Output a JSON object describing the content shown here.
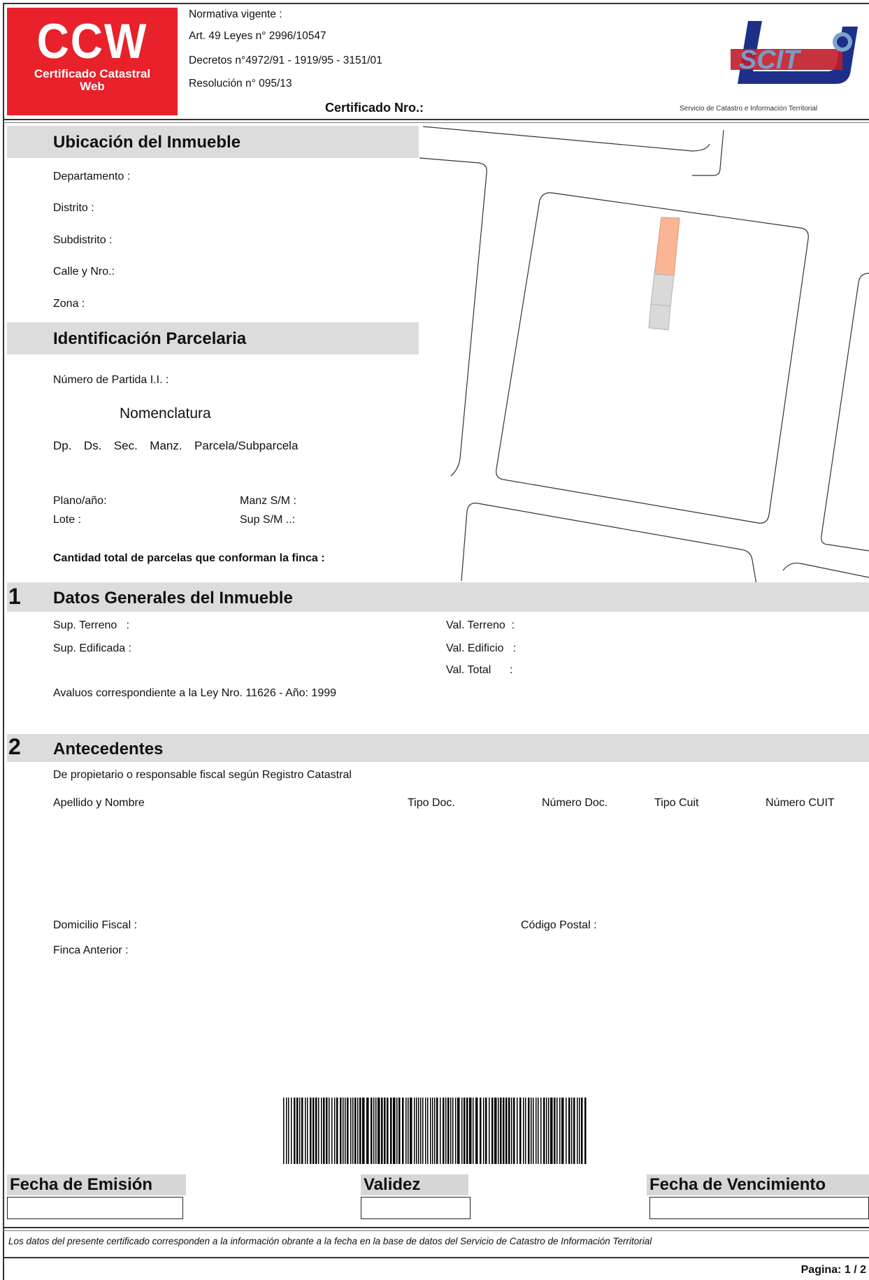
{
  "header": {
    "logo": {
      "line1": "CCW",
      "line2": "Certificado Catastral",
      "line3": "Web"
    },
    "normativa": [
      "Normativa vigente :",
      "Art. 49 Leyes n° 2996/10547",
      "Decretos n°4972/91 - 1919/95 - 3151/01",
      "Resolución n° 095/13"
    ],
    "certificado_label": "Certificado Nro.:",
    "sct_logo": {
      "text": "SCIT",
      "caption": "Servicio de Catastro e Información Territorial"
    }
  },
  "ubicacion": {
    "title": "Ubicación del Inmueble",
    "fields": [
      "Departamento :",
      "Distrito :",
      "Subdistrito :",
      "Calle y Nro.:",
      "Zona :"
    ]
  },
  "identificacion": {
    "title": "Identificación Parcelaria",
    "partida": "Número de Partida I.I. :",
    "nomenclatura": "Nomenclatura",
    "nomen_cols": "Dp.  Ds.  Sec.  Manz.  Parcela/Subparcela",
    "plano": "Plano/año:",
    "manz_sm": "Manz S/M :",
    "lote": "Lote :",
    "sup_sm": "Sup S/M ..:",
    "cantidad": "Cantidad total de parcelas que conforman la finca :"
  },
  "datos_generales": {
    "number": "1",
    "title": "Datos Generales del Inmueble",
    "sup_terreno": "Sup. Terreno   :",
    "sup_edificada": "Sup. Edificada :",
    "val_terreno": "Val. Terreno  :",
    "val_edificio": "Val. Edificio   :",
    "val_total": "Val. Total      :",
    "avaluos": "Avaluos correspondiente a la Ley Nro. 11626 - Año: 1999"
  },
  "antecedentes": {
    "number": "2",
    "title": "Antecedentes",
    "subtitle": "De propietario o responsable fiscal según Registro Catastral",
    "columns": [
      "Apellido y Nombre",
      "Tipo Doc.",
      "Número Doc.",
      "Tipo Cuit",
      "Número CUIT"
    ],
    "domicilio": "Domicilio Fiscal :",
    "codigo_postal": "Código Postal :",
    "finca_anterior": "Finca Anterior :"
  },
  "footer": {
    "emision": "Fecha de Emisión",
    "validez": "Validez",
    "vencimiento": "Fecha de Vencimiento",
    "disclaimer": "Los datos del presente certificado corresponden a la información obrante a la fecha en la base de datos del Servicio de Catastro de Información Territorial",
    "page": "Pagina: 1 / 2"
  },
  "colors": {
    "brand_red": "#e8212b",
    "section_gray": "#dcdcdc",
    "parcel_highlight": "#f9b594",
    "parcel_gray": "#d9d9d9",
    "scit_blue": "#1e2f8a"
  }
}
